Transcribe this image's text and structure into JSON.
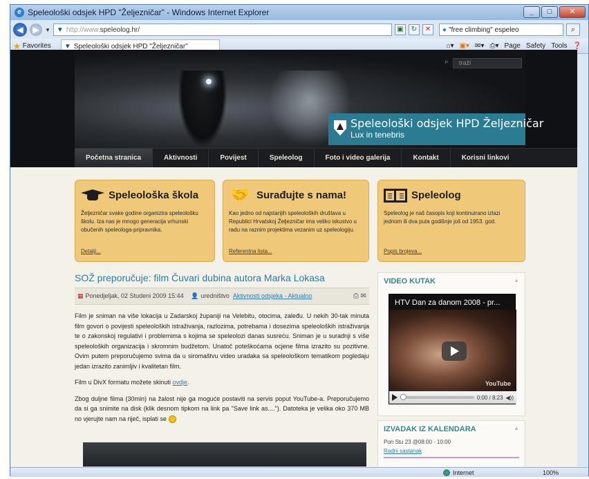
{
  "browser": {
    "window_title": "Speleološki odsjek HPD \"Željezničar\" - Windows Internet Explorer",
    "url_prefix": "http://www.",
    "url_domain": "speleolog.hr/",
    "search_query": "\"free climbing\" espeleo",
    "favorites_label": "Favorites",
    "tab_title": "Speleološki odsjek HPD \"Željezničar\"",
    "tools": [
      "Page",
      "Safety",
      "Tools"
    ],
    "status_zone": "Internet",
    "zoom": "100%"
  },
  "site": {
    "search_placeholder": "traži",
    "title": "Speleološki odsjek HPD Željezničar",
    "motto": "Lux in tenebris",
    "nav": [
      "Početna stranica",
      "Aktivnosti",
      "Povijest",
      "Speleolog",
      "Foto i video galerija",
      "Kontakt",
      "Korisni linkovi"
    ]
  },
  "boxes": [
    {
      "title": "Speleološka škola",
      "icon": "graduation-cap-icon",
      "text": "Željezničar svake godine organizira speleološku školu. Iza nas je mnogo generacija vrhunski obučenih speleologa-pripravnika.",
      "link": "Detalji..."
    },
    {
      "title": "Surađujte s nama!",
      "icon": "handshake-icon",
      "text": "Kao jedno od najstarijih speleoloških društava u Republici Hrvatskoj Željezničar ima veliko iskustvo u radu na raznim projektima vezanim uz speleologiju.",
      "link": "Referentna lista..."
    },
    {
      "title": "Speleolog",
      "icon": "book-icon",
      "text": "Speleolog je naš časopis koji kontinuirano izlazi jednom ili dva puta godišnje još od 1953. god.",
      "link": "Popis brojeva..."
    }
  ],
  "article": {
    "title": "SOŽ preporučuje: film Čuvari dubina autora Marka Lokasa",
    "date": "Ponedjeljak, 02 Studeni 2009 15:44",
    "author": "uredništvo",
    "category": "Aktivnosti odsjeka - Aktualno",
    "paragraphs": [
      "Film je sniman na više lokacija u Zadarskoj županiji na Velebitu, otocima, zaleđu. U nekih 30-tak minuta film govori o povijesti speleoloških istraživanja, razlozima, potrebama i dosezima speleoloških istraživanja te o zakonskoj regulativi i problemima s kojima se speleolozi danas susreću. Sniman je u suradnji s više speleoloških organizacija i skromnim budžetom. Unatoč poteškoćama ocjene filma izrazito su pozitivne. Ovim putem preporučujemo svima da u siromaštvu video uradaka sa speleološkom tematikom pogledaju jedan izrazito zanimljiv i kvalitetan film."
    ],
    "download_prefix": "Film u DivX formatu možete skinuti ",
    "download_link": "ovdje",
    "download_suffix": ".",
    "note": "Zbog duljne filma (30min) na žalost nije ga moguće postaviti na servis poput YouTube-a. Preporučujemo da si ga snimite na disk (klik desnom tipkom na link pa \"Save link as....\"). Datoteka je velika oko 370 MB no vjerujte nam na riječ, isplati se"
  },
  "sidebar": {
    "video_heading": "VIDEO KUTAK",
    "video_title": "HTV Dan za danom 2008 - pr...",
    "video_time": "0:00 / 8:23",
    "video_logo": "YouTube",
    "calendar_heading": "IZVADAK IZ KALENDARA",
    "calendar_date": "Pon Stu 23 @08:00 - 10:00",
    "calendar_event": "Radni sastanak"
  }
}
